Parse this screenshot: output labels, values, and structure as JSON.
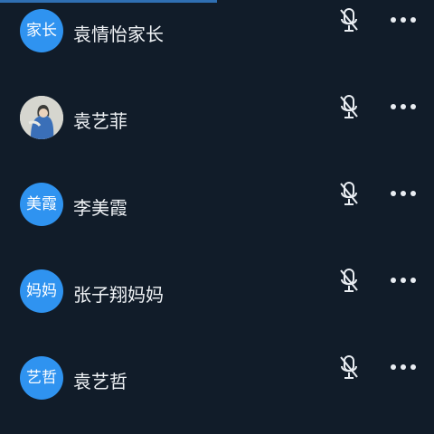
{
  "colors": {
    "background": "#111c29",
    "avatar_blue": "#2f93f0",
    "text": "#f0f3f6",
    "icon": "#e9edf2",
    "top_indicator": "#2f6fb3"
  },
  "members": [
    {
      "avatar_text": "家长",
      "name": "袁情怡家长",
      "avatar_type": "text"
    },
    {
      "avatar_text": "",
      "name": "袁艺菲",
      "avatar_type": "photo"
    },
    {
      "avatar_text": "美霞",
      "name": "李美霞",
      "avatar_type": "text"
    },
    {
      "avatar_text": "妈妈",
      "name": "张子翔妈妈",
      "avatar_type": "text"
    },
    {
      "avatar_text": "艺哲",
      "name": "袁艺哲",
      "avatar_type": "text"
    }
  ],
  "icons": {
    "mic": "microphone-muted-icon",
    "more": "more-horizontal-icon"
  }
}
